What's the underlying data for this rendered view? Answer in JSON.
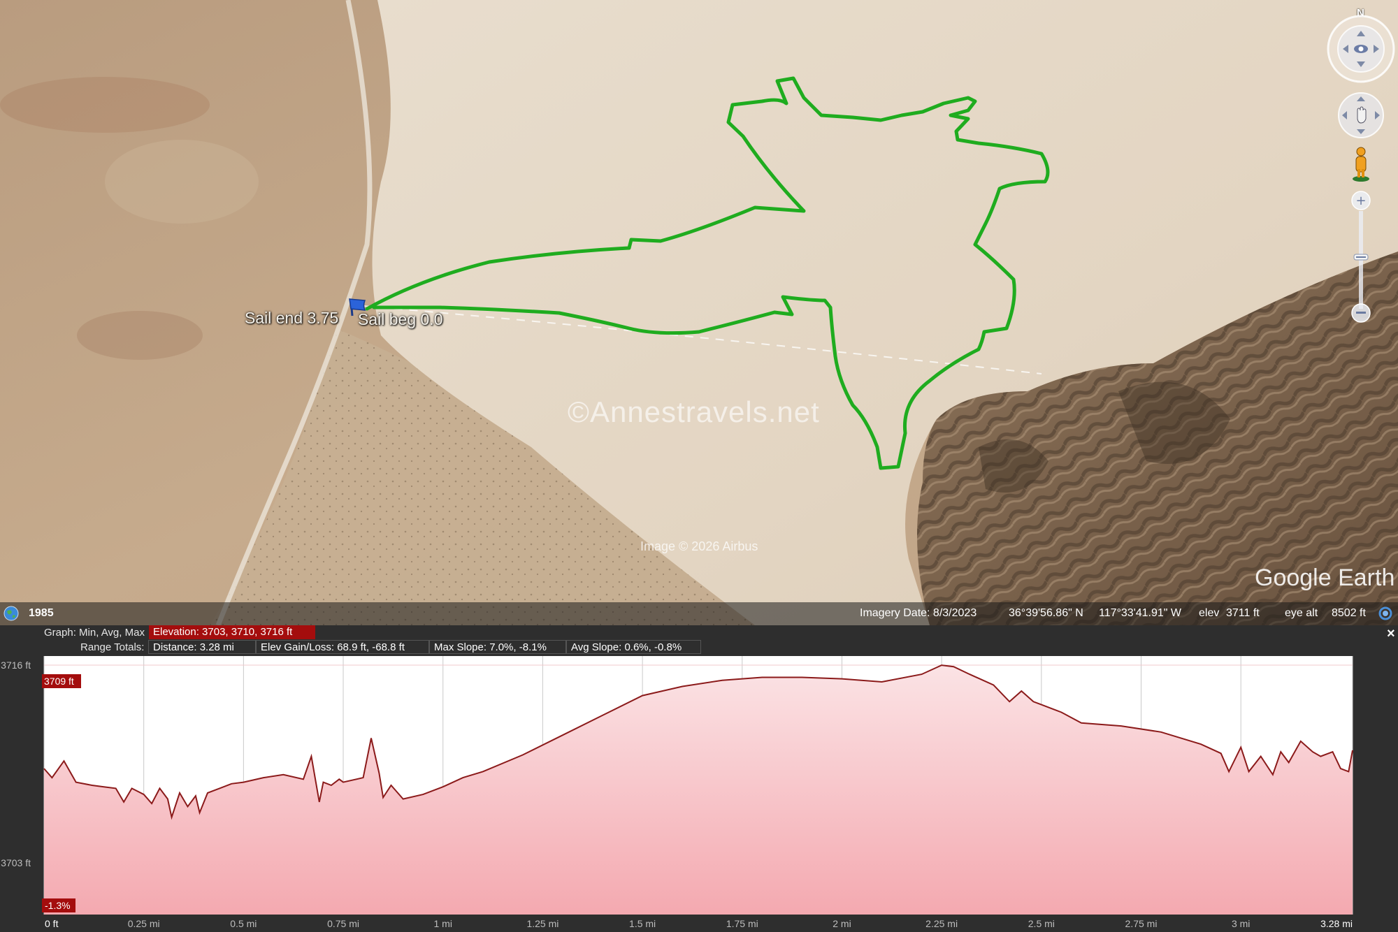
{
  "map": {
    "markers": {
      "end_label": "Sail end 3.75",
      "beg_label": "Sail beg 0.0"
    },
    "watermark": "©Annestravels.net",
    "image_credit": "Image © 2026 Airbus",
    "logo": "Google Earth",
    "compass_north": "N",
    "track_color": "#22b222"
  },
  "status_bar": {
    "year": "1985",
    "imagery_date": "Imagery Date: 8/3/2023",
    "latitude": "36°39'56.86\" N",
    "longitude": "117°33'41.91\" W",
    "elev_label": "elev",
    "elev_value": "3711 ft",
    "eye_alt_label": "eye alt",
    "eye_alt_value": "8502 ft"
  },
  "elevation_panel": {
    "graph_label": "Graph: Min, Avg, Max",
    "elevation_stat": "Elevation: 3703, 3710, 3716 ft",
    "range_label": "Range Totals:",
    "distance": "Distance: 3.28 mi",
    "elev_gain_loss": "Elev Gain/Loss: 68.9 ft, -68.8 ft",
    "max_slope": "Max Slope: 7.0%, -8.1%",
    "avg_slope": "Avg Slope: 0.6%, -0.8%",
    "close_symbol": "×",
    "stat_highlight_color": "#a40d0d"
  },
  "chart_data": {
    "type": "area",
    "ylim": [
      3699.6,
      3716.6
    ],
    "xlim": [
      0,
      3.28
    ],
    "y_tick_labels": [
      {
        "value": 3716,
        "label": "3716 ft"
      },
      {
        "value": 3703,
        "label": "3703 ft"
      }
    ],
    "x_tick_labels": [
      {
        "value": 0,
        "label": "0 ft"
      },
      {
        "value": 0.25,
        "label": "0.25 mi"
      },
      {
        "value": 0.5,
        "label": "0.5 mi"
      },
      {
        "value": 0.75,
        "label": "0.75 mi"
      },
      {
        "value": 1,
        "label": "1 mi"
      },
      {
        "value": 1.25,
        "label": "1.25 mi"
      },
      {
        "value": 1.5,
        "label": "1.5 mi"
      },
      {
        "value": 1.75,
        "label": "1.75 mi"
      },
      {
        "value": 2,
        "label": "2 mi"
      },
      {
        "value": 2.25,
        "label": "2.25 mi"
      },
      {
        "value": 2.5,
        "label": "2.5 mi"
      },
      {
        "value": 2.75,
        "label": "2.75 mi"
      },
      {
        "value": 3,
        "label": "3 mi"
      },
      {
        "value": 3.28,
        "label": "3.28 mi"
      }
    ],
    "cursor_elevation_label": "3709 ft",
    "cursor_slope_label": "-1.3%",
    "profile": {
      "x": [
        0,
        0.02,
        0.05,
        0.08,
        0.12,
        0.15,
        0.18,
        0.2,
        0.22,
        0.25,
        0.27,
        0.29,
        0.31,
        0.32,
        0.34,
        0.36,
        0.38,
        0.39,
        0.41,
        0.44,
        0.47,
        0.5,
        0.55,
        0.6,
        0.65,
        0.67,
        0.69,
        0.7,
        0.72,
        0.74,
        0.75,
        0.8,
        0.82,
        0.84,
        0.85,
        0.87,
        0.9,
        0.95,
        1.0,
        1.05,
        1.1,
        1.2,
        1.3,
        1.4,
        1.5,
        1.6,
        1.7,
        1.8,
        1.9,
        2.0,
        2.1,
        2.2,
        2.25,
        2.28,
        2.32,
        2.38,
        2.42,
        2.45,
        2.48,
        2.5,
        2.55,
        2.6,
        2.7,
        2.8,
        2.9,
        2.95,
        2.97,
        3.0,
        3.02,
        3.05,
        3.08,
        3.1,
        3.12,
        3.15,
        3.18,
        3.2,
        3.23,
        3.25,
        3.27,
        3.28
      ],
      "y": [
        3709.2,
        3708.6,
        3709.7,
        3708.3,
        3708.1,
        3708.0,
        3707.9,
        3707.0,
        3707.9,
        3707.5,
        3706.9,
        3707.9,
        3707.2,
        3706.0,
        3707.6,
        3706.7,
        3707.4,
        3706.3,
        3707.6,
        3707.9,
        3708.2,
        3708.3,
        3708.6,
        3708.8,
        3708.5,
        3710.0,
        3707.0,
        3708.3,
        3708.1,
        3708.5,
        3708.3,
        3708.6,
        3711.2,
        3708.9,
        3707.3,
        3708.1,
        3707.2,
        3707.5,
        3708.0,
        3708.6,
        3709.0,
        3710.1,
        3711.4,
        3712.7,
        3714.0,
        3714.6,
        3715.0,
        3715.2,
        3715.2,
        3715.1,
        3714.9,
        3715.4,
        3716.0,
        3715.9,
        3715.4,
        3714.7,
        3713.6,
        3714.3,
        3713.6,
        3713.4,
        3712.9,
        3712.2,
        3712.0,
        3711.6,
        3710.8,
        3710.2,
        3709.0,
        3710.6,
        3709.0,
        3710.0,
        3708.8,
        3710.3,
        3709.6,
        3711.0,
        3710.3,
        3710.0,
        3710.3,
        3709.2,
        3709.0,
        3710.4
      ]
    }
  }
}
